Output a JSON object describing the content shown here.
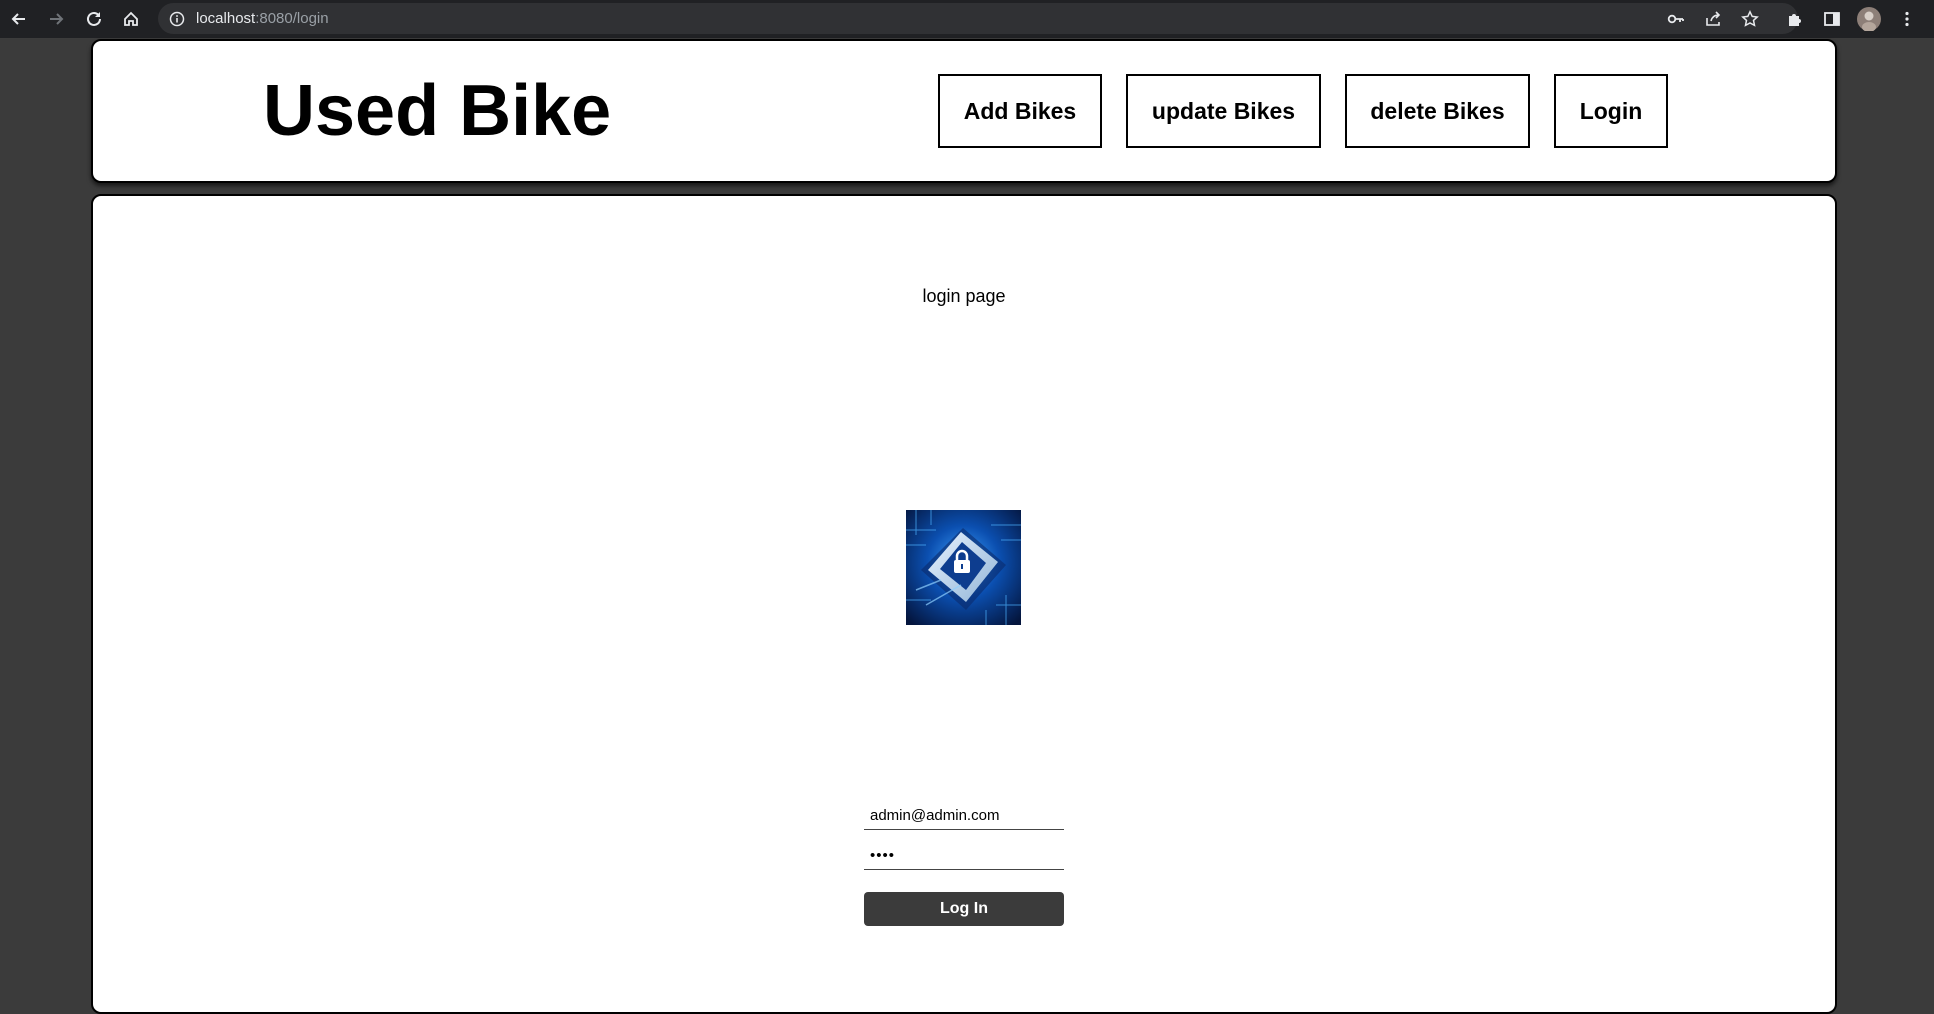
{
  "browser": {
    "url_host": "localhost",
    "url_path": ":8080/login"
  },
  "header": {
    "title": "Used Bike",
    "nav": [
      {
        "label": "Add Bikes"
      },
      {
        "label": "update Bikes"
      },
      {
        "label": "delete Bikes"
      },
      {
        "label": "Login"
      }
    ]
  },
  "main": {
    "heading": "login page",
    "form": {
      "email_value": "admin@admin.com",
      "password_value": "••••",
      "submit_label": "Log In"
    }
  },
  "colors": {
    "background": "#3b3b3b",
    "card": "#ffffff",
    "button_dark": "#3b3b3b",
    "chrome": "#202124"
  }
}
